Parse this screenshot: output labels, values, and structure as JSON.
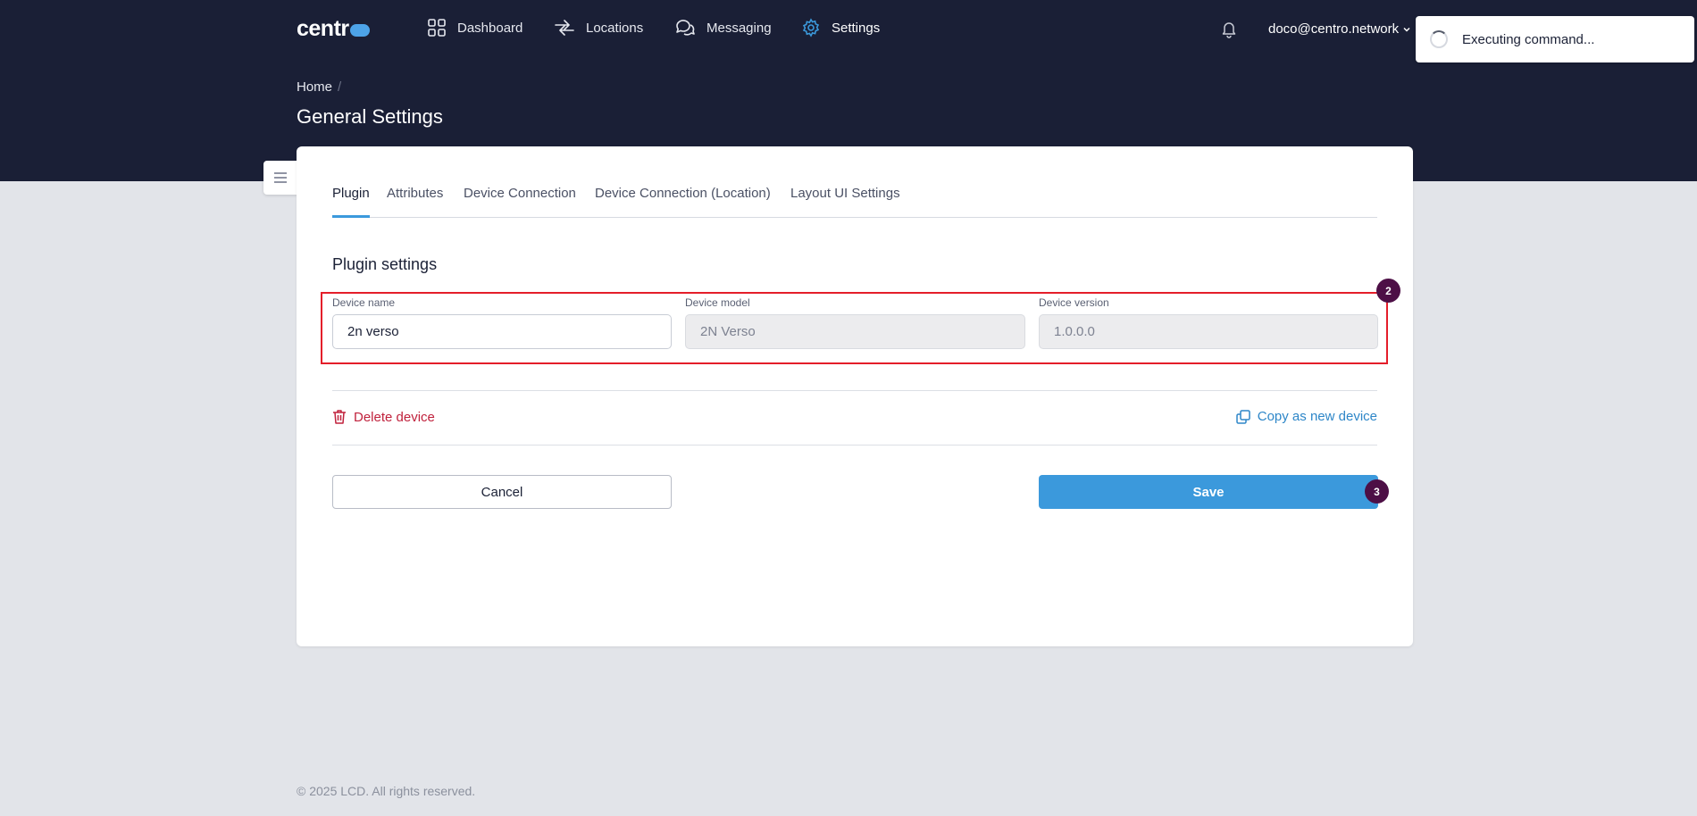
{
  "header": {
    "logo": "centr",
    "nav": [
      {
        "label": "Dashboard",
        "icon": "dashboard-icon"
      },
      {
        "label": "Locations",
        "icon": "locations-icon"
      },
      {
        "label": "Messaging",
        "icon": "messaging-icon"
      },
      {
        "label": "Settings",
        "icon": "gear-icon",
        "active": true
      }
    ],
    "user_email": "doco@centro.network"
  },
  "toast": {
    "message": "Executing command..."
  },
  "breadcrumb": {
    "home": "Home",
    "separator": "/"
  },
  "page_title": "General Settings",
  "tabs": [
    "Plugin",
    "Attributes",
    "Device Connection",
    "Device Connection (Location)",
    "Layout UI Settings"
  ],
  "plugin": {
    "section_title": "Plugin settings",
    "fields": [
      {
        "label": "Device name",
        "value": "2n verso"
      },
      {
        "label": "Device model",
        "value": "2N Verso"
      },
      {
        "label": "Device version",
        "value": "1.0.0.0"
      }
    ],
    "delete_label": "Delete device",
    "copy_label": "Copy as new device",
    "cancel_label": "Cancel",
    "save_label": "Save"
  },
  "annotations": {
    "fields_badge": "2",
    "save_badge": "3"
  },
  "footer": "© 2025 LCD. All rights reserved.",
  "colors": {
    "header_bg": "#1a1f36",
    "accent": "#3b99dc",
    "danger": "#c0213c",
    "highlight": "#e41e2a",
    "badge": "#4d0f46"
  }
}
